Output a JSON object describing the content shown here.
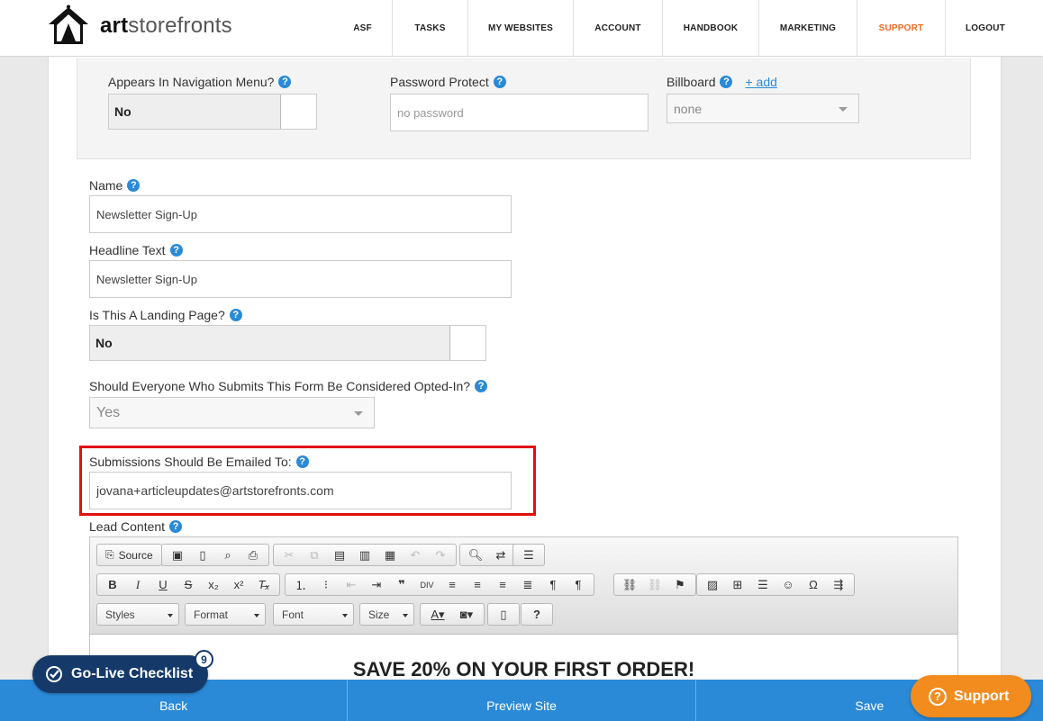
{
  "header": {
    "logo_bold": "art",
    "logo_rest": "storefronts",
    "nav": [
      {
        "label": "ASF"
      },
      {
        "label": "TASKS"
      },
      {
        "label": "MY WEBSITES"
      },
      {
        "label": "ACCOUNT"
      },
      {
        "label": "HANDBOOK"
      },
      {
        "label": "MARKETING"
      },
      {
        "label": "SUPPORT",
        "active": true
      },
      {
        "label": "LOGOUT"
      }
    ],
    "accent_color": "#f26a21"
  },
  "top_settings": {
    "nav_menu_label": "Appears In Navigation Menu?",
    "nav_menu_value": "No",
    "password_label": "Password Protect",
    "password_placeholder": "no password",
    "billboard_label": "Billboard",
    "billboard_add": "+ add",
    "billboard_value": "none"
  },
  "form": {
    "name_label": "Name",
    "name_value": "Newsletter Sign-Up",
    "headline_label": "Headline Text",
    "headline_value": "Newsletter Sign-Up",
    "landing_label": "Is This A Landing Page?",
    "landing_value": "No",
    "optin_label": "Should Everyone Who Submits This Form Be Considered Opted-In?",
    "optin_value": "Yes",
    "email_label": "Submissions Should Be Emailed To:",
    "email_value": "jovana+articleupdates@artstorefronts.com",
    "lead_label": "Lead Content"
  },
  "editor": {
    "source_label": "Source",
    "combos": {
      "styles": "Styles",
      "format": "Format",
      "font": "Font",
      "size": "Size"
    },
    "headline": "SAVE 20% ON YOUR FIRST ORDER!"
  },
  "bottom_bar": {
    "back": "Back",
    "preview": "Preview Site",
    "save": "Save",
    "color": "#2a8ad8"
  },
  "golive": {
    "label": "Go-Live Checklist",
    "count": "9"
  },
  "support_button": {
    "label": "Support",
    "color": "#f28c1f"
  },
  "help_glyph": "?"
}
